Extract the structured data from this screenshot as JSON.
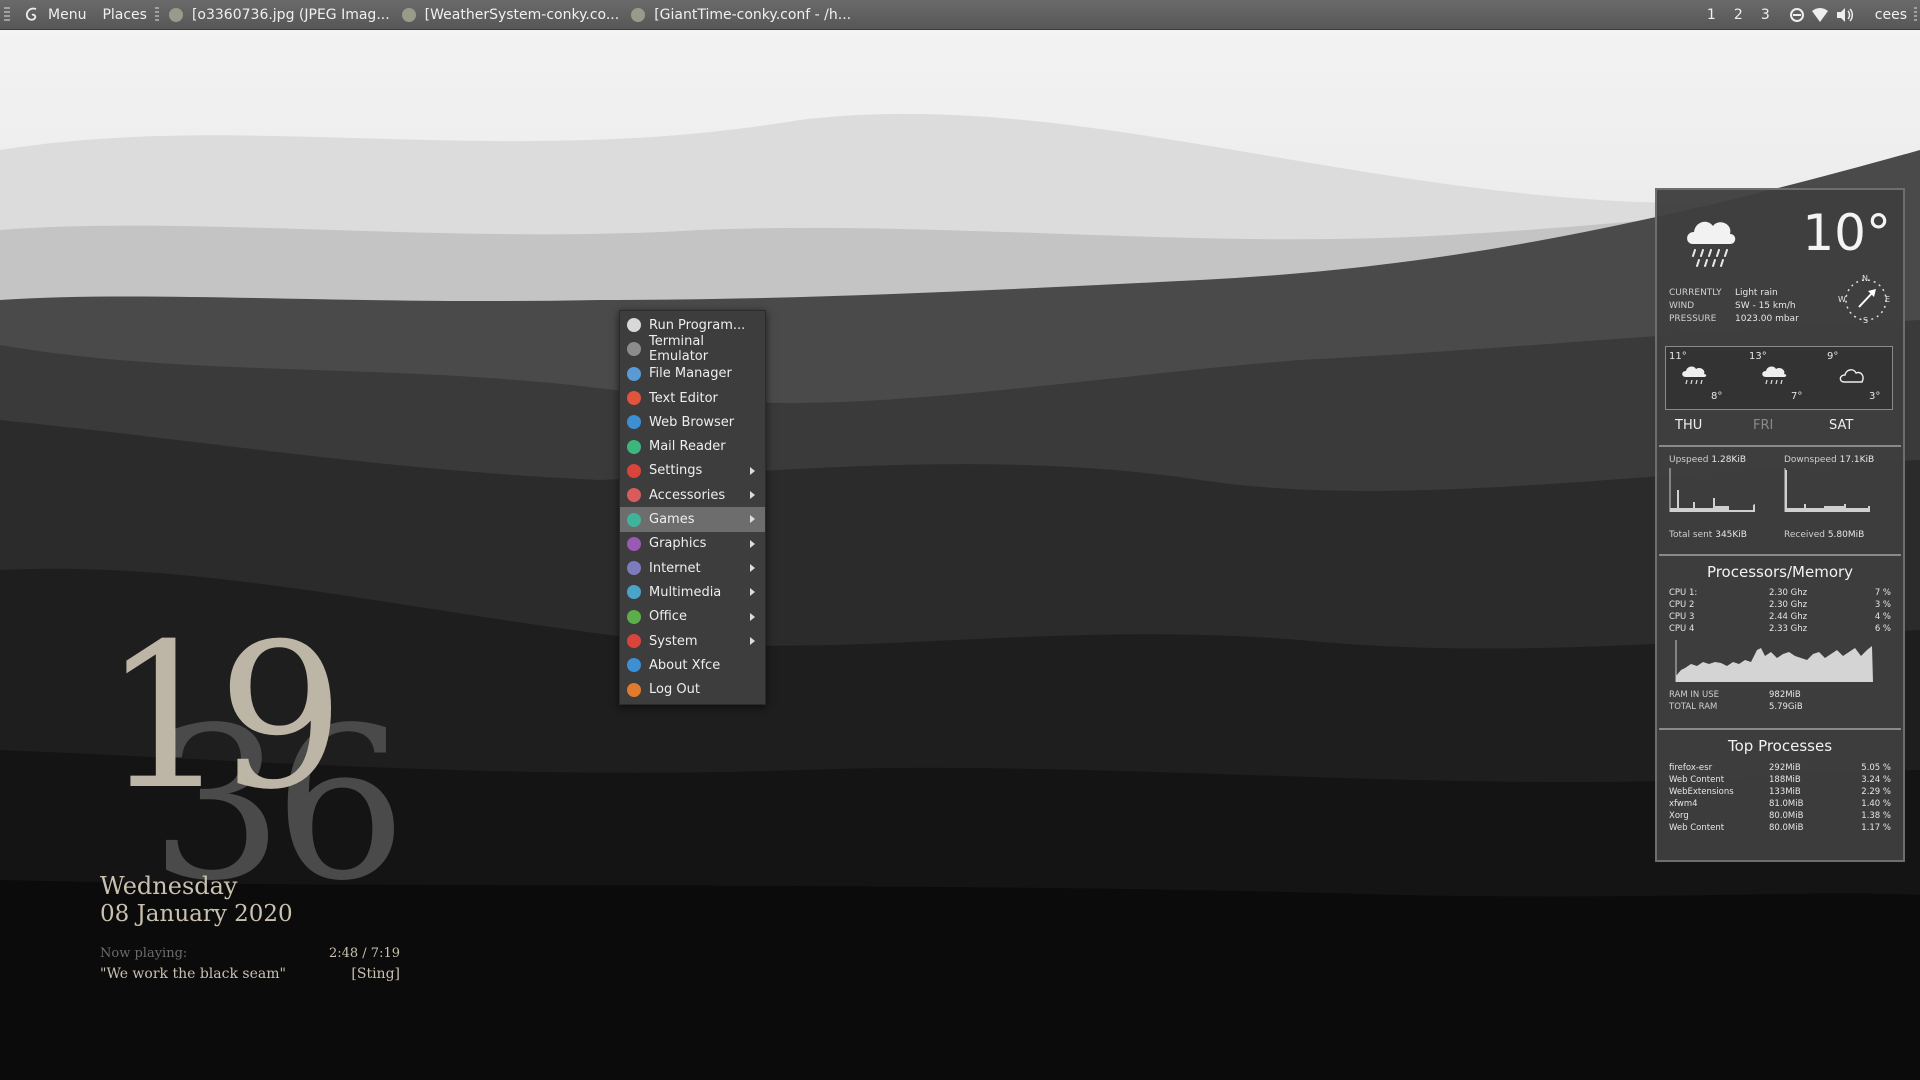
{
  "panel": {
    "menu_label": "Menu",
    "places_label": "Places",
    "tasks": [
      "[o3360736.jpg (JPEG Imag...",
      "[WeatherSystem-conky.co...",
      "[GiantTime-conky.conf - /h..."
    ],
    "workspaces": [
      "1",
      "2",
      "3"
    ],
    "user": "cees"
  },
  "menu": {
    "items": [
      {
        "label": "Run Program...",
        "icon": "run-icon",
        "submenu": false,
        "color": "#d8d8d8"
      },
      {
        "label": "Terminal Emulator",
        "icon": "terminal-icon",
        "submenu": false,
        "color": "#8c8c8c"
      },
      {
        "label": "File Manager",
        "icon": "folder-icon",
        "submenu": false,
        "color": "#5b9bd5"
      },
      {
        "label": "Text Editor",
        "icon": "pencil-icon",
        "submenu": false,
        "color": "#e0533c"
      },
      {
        "label": "Web Browser",
        "icon": "globe-icon",
        "submenu": false,
        "color": "#3d8fd4"
      },
      {
        "label": "Mail Reader",
        "icon": "mail-icon",
        "submenu": false,
        "color": "#3cb67d"
      },
      {
        "label": "Settings",
        "icon": "settings-icon",
        "submenu": true,
        "color": "#d9443d"
      },
      {
        "label": "Accessories",
        "icon": "accessories-icon",
        "submenu": true,
        "color": "#d95b5b"
      },
      {
        "label": "Games",
        "icon": "gamepad-icon",
        "submenu": true,
        "color": "#3fb39c"
      },
      {
        "label": "Graphics",
        "icon": "graphics-icon",
        "submenu": true,
        "color": "#9b59b6"
      },
      {
        "label": "Internet",
        "icon": "internet-icon",
        "submenu": true,
        "color": "#7b7bbd"
      },
      {
        "label": "Multimedia",
        "icon": "multimedia-icon",
        "submenu": true,
        "color": "#4aa3c8"
      },
      {
        "label": "Office",
        "icon": "office-icon",
        "submenu": true,
        "color": "#5cae4a"
      },
      {
        "label": "System",
        "icon": "system-icon",
        "submenu": true,
        "color": "#d9443d"
      },
      {
        "label": "About Xfce",
        "icon": "info-icon",
        "submenu": false,
        "color": "#3d8fd4"
      },
      {
        "label": "Log Out",
        "icon": "logout-icon",
        "submenu": false,
        "color": "#e07a2c"
      }
    ],
    "active_index": 8
  },
  "clock": {
    "hour": "19",
    "minute": "36",
    "weekday": "Wednesday",
    "date": "08 January 2020",
    "now_playing_label": "Now playing:",
    "elapsed": "2:48 / 7:19",
    "track": "\"We work the black seam\"",
    "artist": "[Sting]"
  },
  "weather": {
    "temp": "10°",
    "currently_label": "CURRENTLY",
    "currently": "Light rain",
    "wind_label": "WIND",
    "wind": "SW - 15 km/h",
    "pressure_label": "PRESSURE",
    "pressure": "1023.00 mbar",
    "compass": {
      "n": "N",
      "e": "E",
      "s": "S",
      "w": "W"
    },
    "forecast": [
      {
        "day": "THU",
        "high": "11°",
        "low": "8°",
        "icon": "rain-icon"
      },
      {
        "day": "FRI",
        "high": "13°",
        "low": "7°",
        "icon": "rain-icon"
      },
      {
        "day": "SAT",
        "high": "9°",
        "low": "3°",
        "icon": "cloud-icon"
      }
    ]
  },
  "network": {
    "upspeed_label": "Upspeed",
    "upspeed": "1.28KiB",
    "downspeed_label": "Downspeed",
    "downspeed": "17.1KiB",
    "sent_label": "Total sent",
    "sent": "345KiB",
    "received_label": "Received",
    "received": "5.80MiB"
  },
  "cpu": {
    "title": "Processors/Memory",
    "cores": [
      {
        "name": "CPU 1:",
        "freq": "2.30 Ghz",
        "pct": "7 %"
      },
      {
        "name": "CPU 2",
        "freq": "2.30 Ghz",
        "pct": "3 %"
      },
      {
        "name": "CPU 3",
        "freq": "2.44 Ghz",
        "pct": "4 %"
      },
      {
        "name": "CPU 4",
        "freq": "2.33 Ghz",
        "pct": "6 %"
      }
    ],
    "ram_label": "RAM IN USE",
    "ram": "982MiB",
    "total_label": "TOTAL RAM",
    "total": "5.79GiB"
  },
  "processes": {
    "title": "Top Processes",
    "rows": [
      {
        "name": "firefox-esr",
        "mem": "292MiB",
        "cpu": "5.05 %"
      },
      {
        "name": "Web Content",
        "mem": "188MiB",
        "cpu": "3.24 %"
      },
      {
        "name": "WebExtensions",
        "mem": "133MiB",
        "cpu": "2.29 %"
      },
      {
        "name": "xfwm4",
        "mem": "81.0MiB",
        "cpu": "1.40 %"
      },
      {
        "name": "Xorg",
        "mem": "80.0MiB",
        "cpu": "1.38 %"
      },
      {
        "name": "Web Content",
        "mem": "80.0MiB",
        "cpu": "1.17 %"
      }
    ]
  }
}
